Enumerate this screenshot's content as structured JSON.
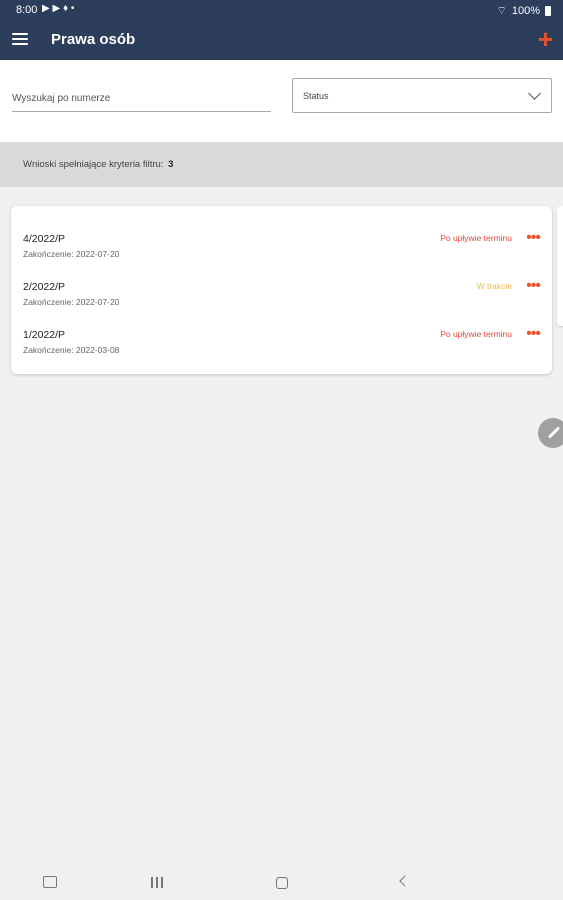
{
  "status_bar": {
    "time": "8:00",
    "battery": "100%"
  },
  "header": {
    "title": "Prawa osób",
    "add_icon": "plus-icon",
    "menu_icon": "hamburger-menu-icon"
  },
  "filters": {
    "search_placeholder": "Wyszukaj po numerze",
    "status_label": "Status"
  },
  "results": {
    "label": "Wnioski spełniające kryteria filtru:",
    "count": "3"
  },
  "items": [
    {
      "number": "4/2022/P",
      "date": "Zakończenie: 2022-07-20",
      "status": "Po upływie terminu",
      "status_color": "#e04a3a"
    },
    {
      "number": "2/2022/P",
      "date": "Zakończenie: 2022-07-20",
      "status": "W trakcie",
      "status_color": "#f5b84a"
    },
    {
      "number": "1/2022/P",
      "date": "Zakończenie: 2022-03-08",
      "status": "Po upływie terminu",
      "status_color": "#e04a3a"
    }
  ],
  "colors": {
    "primary": "#2c3e5c",
    "accent": "#e8502e"
  }
}
